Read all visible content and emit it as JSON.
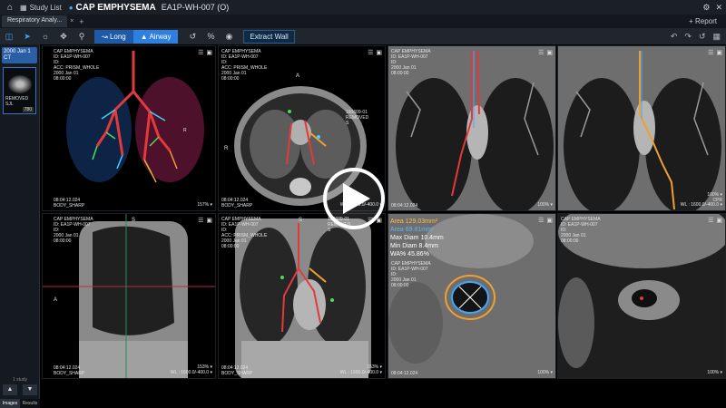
{
  "topbar": {
    "study_list": "Study List",
    "patient": "CAP EMPHYSEMA",
    "patient_id": "EA1P-WH-007 (O)"
  },
  "tabs": [
    {
      "label": "Respiratory Analy..."
    }
  ],
  "tab_add": "+",
  "report": "+ Report",
  "toolbar": {
    "long": "Long",
    "airway": "Airway",
    "extract_wall": "Extract Wall"
  },
  "sidebar": {
    "series_date": "2000 Jan 1\nCT",
    "thumb_label": "REMOVED SJL",
    "thumb_count": "780",
    "study_count": "1 study",
    "tab_images": "Images",
    "tab_results": "Results"
  },
  "viewports": {
    "vp1": {
      "info": "CAP EMPHYSEMA\nID: EA1P-WH-007\nID:\nACC: PRISM_WHOLE\n2000 Jan 01\n08:00:00",
      "info_right": "R",
      "bottom_left": "08:04:12.024\nBODY_SHARP",
      "zoom": "157% ▾"
    },
    "vp2": {
      "info": "CAP EMPHYSEMA\nID: EA1P-WH-007\nID:\nACC: PRISM_WHOLE\n2000 Jan 01\n08:00:00",
      "info_right": "160609-01\nREMOVED\nS",
      "bottom_left": "08:04:12.024\nBODY_SHARP",
      "zoom": "WL : 1600.0/-400.0 ▾",
      "label_a": "A",
      "label_r": "R"
    },
    "vp3": {
      "info": "CAP EMPHYSEMA\nID: EA1P-WH-007\nID:\n2000 Jan 01\n08:00:00",
      "bottom_left": "08:04:12.024",
      "zoom": "100% ▾"
    },
    "vp4": {
      "zoom": "100% ▾",
      "cpr": "CPR",
      "wl": "WL : 1600.0/-400.0 ▾"
    },
    "vp5": {
      "info": "CAP EMPHYSEMA\nID: EA1P-WH-007\nID:\n2000 Jan 01\n08:00:00",
      "label_s": "S",
      "label_a": "A",
      "bottom_left": "08:04:12.024\nBODY_SHARP",
      "zoom": "153% ▾",
      "wl": "WL : 1600.0/-400.0 ▾"
    },
    "vp6": {
      "info": "CAP EMPHYSEMA\nID: EA1P-WH-007\nID:\nACC: PRISM_WHOLE\n2000 Jan 01\n08:00:00",
      "info_right": "160609-01\nREMOVED\nS",
      "label_s": "S",
      "bottom_left": "08:04:12.024\nBODY_SHARP",
      "zoom": "153% ▾",
      "wl": "WL : 1600.0/-400.0 ▾"
    },
    "vp7": {
      "area1": "Area 129.03mm²",
      "area2": "Area 69.81mm²",
      "max_diam": "Max Diam  10.4mm",
      "min_diam": "Min Diam   8.4mm",
      "wa": "WA%   45.86%",
      "info": "CAP EMPHYSEMA\nID: EA1P-WH-007\nID:\n2000 Jan 01\n08:00:00",
      "bottom_left": "08:04:12.024",
      "zoom": "100% ▾"
    },
    "vp8": {
      "info": "CAP EMPHYSEMA\nID: EA1P-WH-007\nID:\n2000 Jan 01\n08:00:00",
      "zoom": "100% ▾"
    }
  }
}
